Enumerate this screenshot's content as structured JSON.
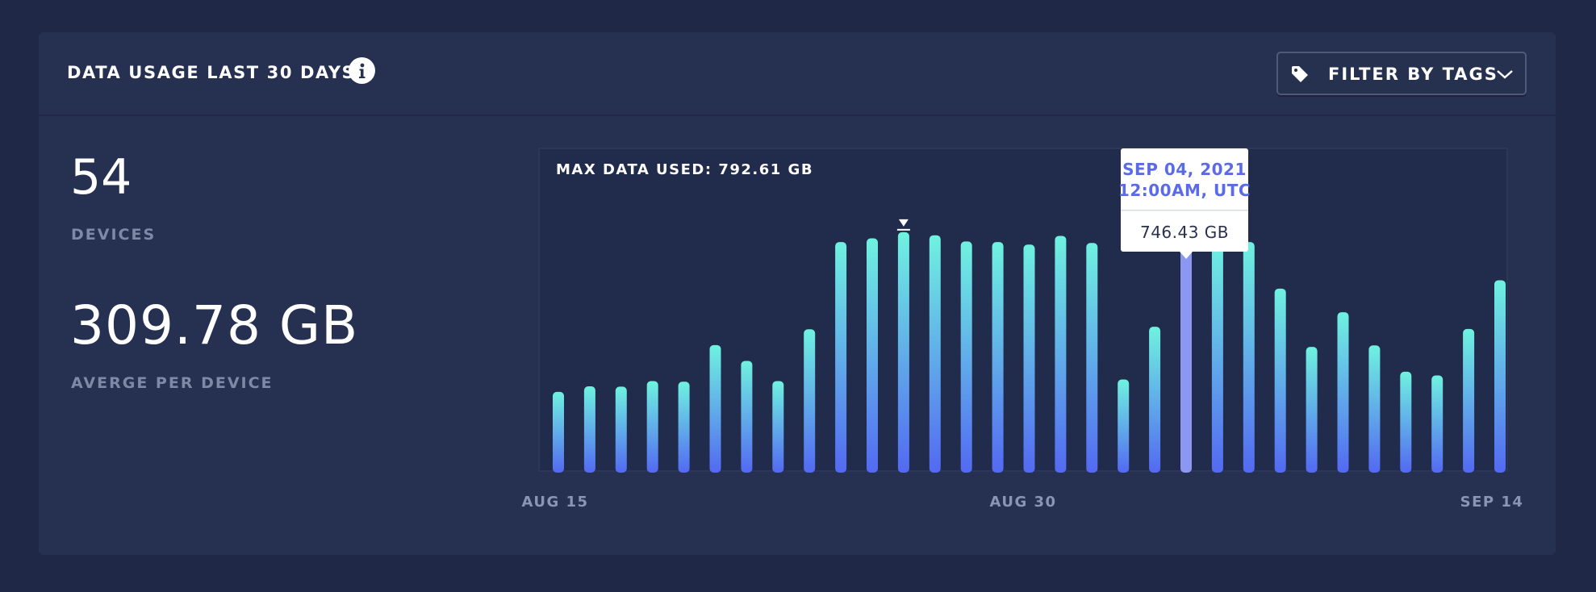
{
  "card": {
    "title": "DATA USAGE LAST 30 DAYS",
    "filter_label": "FILTER BY TAGS"
  },
  "stats": {
    "devices_value": "54",
    "devices_label": "DEVICES",
    "average_value": "309.78 GB",
    "average_label": "AVERGE PER DEVICE"
  },
  "colors": {
    "background": "#1f2846",
    "card": "#263152",
    "plot_background": "#212b4c",
    "bar_top": "#6ff2e0",
    "bar_bottom": "#5369f2",
    "bar_selected": "#8b97f0",
    "tooltip_date": "#5b6be6"
  },
  "chart_data": {
    "type": "bar",
    "title": "",
    "max_label": "MAX DATA USED: 792.61 GB",
    "xlabel": "",
    "ylabel": "",
    "x_tick_labels": [
      "AUG 15",
      "AUG 30",
      "SEP 14"
    ],
    "categories": [
      "2021-08-15",
      "2021-08-16",
      "2021-08-17",
      "2021-08-18",
      "2021-08-19",
      "2021-08-20",
      "2021-08-21",
      "2021-08-22",
      "2021-08-23",
      "2021-08-24",
      "2021-08-25",
      "2021-08-26",
      "2021-08-27",
      "2021-08-28",
      "2021-08-29",
      "2021-08-30",
      "2021-08-31",
      "2021-09-01",
      "2021-09-02",
      "2021-09-03",
      "2021-09-04",
      "2021-09-05",
      "2021-09-06",
      "2021-09-07",
      "2021-09-08",
      "2021-09-09",
      "2021-09-10",
      "2021-09-11",
      "2021-09-12",
      "2021-09-13",
      "2021-09-14"
    ],
    "values": [
      255,
      273,
      272,
      290,
      288,
      406,
      355,
      290,
      457,
      738,
      750,
      770,
      760,
      740,
      738,
      730,
      758,
      735,
      295,
      465,
      746.43,
      740,
      738,
      588,
      400,
      512,
      405,
      320,
      308,
      458,
      615
    ],
    "max_value": 792.61,
    "max_index": 11,
    "ylim": [
      0,
      1040
    ],
    "grid": false,
    "legend": "none",
    "tooltip": {
      "index": 20,
      "date_line1": "SEP 04, 2021",
      "date_line2": "12:00AM, UTC",
      "value_label": "746.43 GB"
    }
  }
}
